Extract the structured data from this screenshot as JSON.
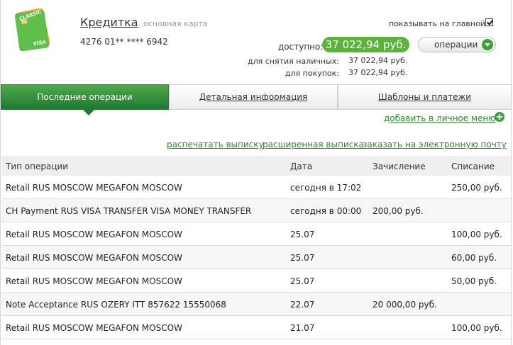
{
  "card": {
    "name": "Кредитка",
    "type": "основная карта",
    "number": "4276 01** **** 6942",
    "image_label": "CLASSIC",
    "image_brand": "VISA"
  },
  "show_on_main": {
    "label": "показывать на главной",
    "checked": true
  },
  "balance": {
    "available_label": "доступно:",
    "available_value": "37 022,94 руб.",
    "cash_label": "для снятия наличных:",
    "cash_value": "37 022,94 руб.",
    "purchase_label": "для покупок:",
    "purchase_value": "37 022,94 руб."
  },
  "operations_button": {
    "label": "операции",
    "icon": "chevron-down-icon"
  },
  "tabs": [
    {
      "label": "Последние операции",
      "active": true
    },
    {
      "label": "Детальная информация",
      "active": false
    },
    {
      "label": "Шаблоны и платежи",
      "active": false
    }
  ],
  "add_to_menu": "добавить в личное меню",
  "actions": {
    "print": "распечатать выписку",
    "extended": "расширенная выписка",
    "email": "заказать на электронную почту"
  },
  "table": {
    "headers": [
      "Тип операции",
      "Дата",
      "Зачисление",
      "Списание"
    ],
    "rows": [
      [
        "Retail RUS MOSCOW MEGAFON MOSCOW",
        "сегодня в 17:02",
        "",
        "250,00 руб."
      ],
      [
        "CH Payment RUS VISA TRANSFER VISA MONEY TRANSFER",
        "сегодня в 00:00",
        "200,00 руб.",
        ""
      ],
      [
        "Retail RUS MOSCOW MEGAFON MOSCOW",
        "25.07",
        "",
        "100,00 руб."
      ],
      [
        "Retail RUS MOSCOW MEGAFON MOSCOW",
        "25.07",
        "",
        "60,00 руб."
      ],
      [
        "Retail RUS MOSCOW MEGAFON MOSCOW",
        "25.07",
        "",
        "50,00 руб."
      ],
      [
        "Note Acceptance RUS OZERY ITT 857622 15550068",
        "22.07",
        "20 000,00 руб.",
        ""
      ],
      [
        "Retail RUS MOSCOW MEGAFON MOSCOW",
        "21.07",
        "",
        "100,00 руб."
      ]
    ]
  },
  "colors": {
    "accent": "#5bb33b",
    "link": "#2d8a2d",
    "tab_active": "#1f7a32"
  }
}
